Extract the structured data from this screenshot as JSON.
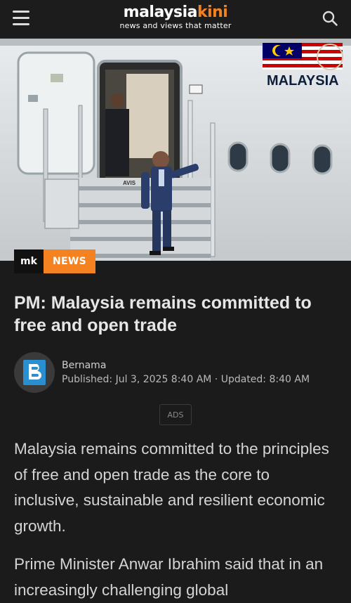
{
  "header": {
    "logo_white": "malaysia",
    "logo_orange": "kini",
    "tagline": "news and views that matter",
    "menu_icon": "hamburger-menu-icon",
    "search_icon": "search-icon"
  },
  "hero": {
    "plane_text": "MALAYSIA",
    "stair_text": "AVIS",
    "badge_short": "mk",
    "badge_label": "NEWS"
  },
  "article": {
    "title": "PM: Malaysia remains committed to free and open trade",
    "author": "Bernama",
    "published_label": "Published:",
    "published": "Jul 3, 2025 8:40 AM",
    "separator": "·",
    "updated_label": "Updated:",
    "updated": "8:40 AM",
    "ads_label": "ADS",
    "paragraphs": [
      "Malaysia remains committed to the principles of free and open trade as the core to inclusive, sustainable and resilient economic growth.",
      "Prime Minister Anwar Ibrahim said that in an increasingly challenging global"
    ]
  },
  "colors": {
    "brand_orange": "#f58220",
    "background": "#1b1b1b"
  }
}
